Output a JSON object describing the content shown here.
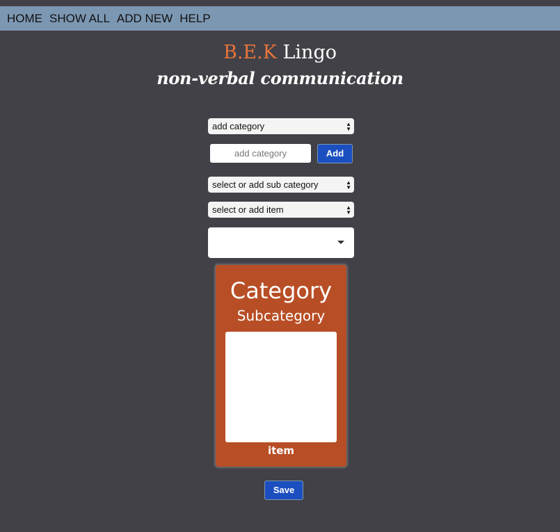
{
  "nav": {
    "items": [
      "HOME",
      "SHOW ALL",
      "ADD NEW",
      "HELP"
    ]
  },
  "header": {
    "brand": "B.E.K",
    "name": "Lingo",
    "subtitle": "non-verbal communication"
  },
  "form": {
    "category_select": "add category",
    "category_input_placeholder": "add category",
    "add_button": "Add",
    "subcategory_select": "select or add sub category",
    "item_select": "select or add item",
    "image_select": ""
  },
  "card": {
    "category": "Category",
    "subcategory": "Subcategory",
    "item": "item"
  },
  "save_button": "Save",
  "colors": {
    "navbar": "#7c97b2",
    "background": "#424147",
    "brand": "#e8743b",
    "card": "#b84e25",
    "button": "#1b4fc0"
  }
}
